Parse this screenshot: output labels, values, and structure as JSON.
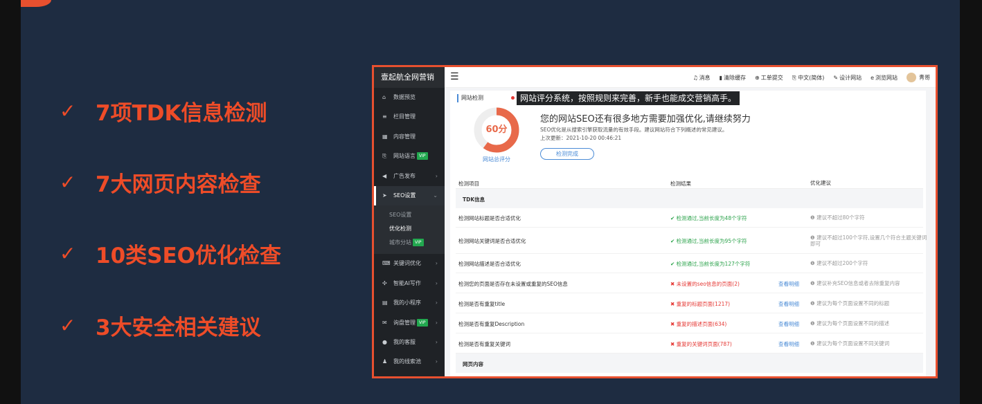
{
  "features": [
    {
      "check": "✓",
      "text": "7项TDK信息检测"
    },
    {
      "check": "✓",
      "text": "7大网页内容检查"
    },
    {
      "check": "✓",
      "text": "10类SEO优化检查"
    },
    {
      "check": "✓",
      "text": "3大安全相关建议"
    }
  ],
  "sidebar": {
    "brand": "壹起航全网营销",
    "items": [
      {
        "icon": "home-icon",
        "glyph": "⌂",
        "label": "数据预览",
        "arrow": ""
      },
      {
        "icon": "list-icon",
        "glyph": "≡",
        "label": "栏目管理",
        "arrow": ""
      },
      {
        "icon": "grid-icon",
        "glyph": "▦",
        "label": "内容管理",
        "arrow": ""
      },
      {
        "icon": "language-icon",
        "glyph": "⎘",
        "label": "网站语言",
        "arrow": "",
        "vip": "VIP"
      },
      {
        "icon": "megaphone-icon",
        "glyph": "◀",
        "label": "广告发布",
        "arrow": "›"
      }
    ],
    "active": {
      "icon": "send-icon",
      "glyph": "➤",
      "label": "SEO设置",
      "arrow": "⌄"
    },
    "sub": [
      {
        "label": "SEO设置"
      },
      {
        "label": "优化检测"
      },
      {
        "label": "城市分站",
        "vip": "VIP"
      }
    ],
    "items2": [
      {
        "icon": "keyboard-icon",
        "glyph": "⌨",
        "label": "关键词优化",
        "arrow": "›"
      },
      {
        "icon": "ai-icon",
        "glyph": "✣",
        "label": "智能AI写作",
        "arrow": "›"
      },
      {
        "icon": "file-icon",
        "glyph": "▤",
        "label": "我的小程序",
        "arrow": "›"
      },
      {
        "icon": "mail-icon",
        "glyph": "✉",
        "label": "询盘管理",
        "arrow": "›",
        "vip": "VIP"
      },
      {
        "icon": "chat-icon",
        "glyph": "●",
        "label": "我的客服",
        "arrow": "›"
      },
      {
        "icon": "user-icon",
        "glyph": "♟",
        "label": "我的线索池",
        "arrow": "›"
      }
    ]
  },
  "topbar": {
    "menu_glyph": "☰",
    "tools": [
      {
        "icon": "bell-icon",
        "glyph": "♫",
        "label": "消息"
      },
      {
        "icon": "trash-icon",
        "glyph": "▮",
        "label": "清除缓存"
      },
      {
        "icon": "support-icon",
        "glyph": "⊕",
        "label": "工单提交"
      },
      {
        "icon": "translate-icon",
        "glyph": "⎘",
        "label": "中文(简体)"
      },
      {
        "icon": "edit-icon",
        "glyph": "✎",
        "label": "设计网站"
      },
      {
        "icon": "browser-icon",
        "glyph": "e",
        "label": "浏览网站"
      }
    ],
    "user": "青哥"
  },
  "content": {
    "crumb": "网站检测",
    "tooltip": "网站评分系统，按照规则来完善，新手也能成交营销高手。",
    "score": {
      "value": 60,
      "max": 100,
      "label": "60分",
      "caption": "网站总评分"
    },
    "headline": "您的网站SEO还有很多地方需要加强优化,请继续努力",
    "desc1": "SEO优化是从搜索引擎获取流量的有效手段。建议网站符合下列概述的常见建议。",
    "desc2": "上次更新：2021-10-20 00:46:21",
    "button": "检测完成",
    "colors": {
      "accent": "#e8694a",
      "ok": "#2aa24a",
      "bad": "#e53935",
      "link": "#4a8bd6",
      "frame": "#e8502f"
    }
  },
  "table": {
    "headers": [
      "检测项目",
      "检测结果",
      "优化建议"
    ],
    "sections": [
      {
        "title": "TDK信息"
      }
    ],
    "rows": [
      {
        "item": "检测网站标题是否合适优化",
        "status": "ok",
        "result": "检测通过,当前长度为48个字符",
        "link": "",
        "advice": "建议不超过80个字符"
      },
      {
        "item": "检测网站关键词是否合适优化",
        "status": "ok",
        "result": "检测通过,当前长度为95个字符",
        "link": "",
        "advice": "建议不超过100个字符,设置几个符合主题关键词即可"
      },
      {
        "item": "检测网站描述是否合适优化",
        "status": "ok",
        "result": "检测通过,当前长度为127个字符",
        "link": "",
        "advice": "建议不超过200个字符"
      },
      {
        "item": "检测您的页面是否存在未设置或重复的SEO信息",
        "status": "bad",
        "result": "未设置的seo信息的页面(2)",
        "link": "查看明细",
        "advice": "建议补充SEO信息或者去除重复内容"
      },
      {
        "item": "检测是否有重复title",
        "status": "bad",
        "result": "重复的标题页面(1217)",
        "link": "查看明细",
        "advice": "建议为每个页面设置不同的标题"
      },
      {
        "item": "检测是否有重复Description",
        "status": "bad",
        "result": "重复的描述页面(634)",
        "link": "查看明细",
        "advice": "建议为每个页面设置不同的描述"
      },
      {
        "item": "检测是否有重复关键词",
        "status": "bad",
        "result": "重复的关键词页面(787)",
        "link": "查看明细",
        "advice": "建议为每个页面设置不同关键词"
      }
    ],
    "section2": "网页内容"
  }
}
